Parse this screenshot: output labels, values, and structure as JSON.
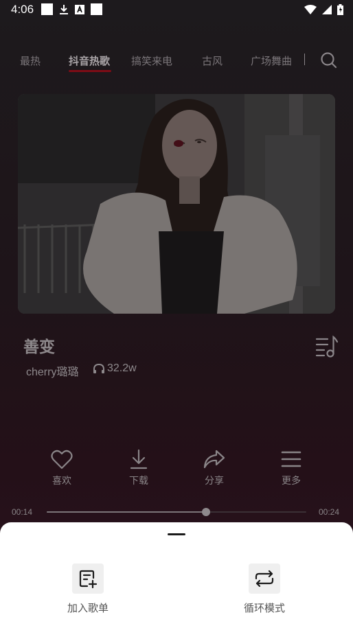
{
  "status_bar": {
    "time": "4:06"
  },
  "tabs": [
    {
      "label": "最热"
    },
    {
      "label": "抖音热歌"
    },
    {
      "label": "搞笑来电"
    },
    {
      "label": "古风"
    },
    {
      "label": "广场舞曲"
    }
  ],
  "song": {
    "title": "善变",
    "artist": "cherry璐璐",
    "plays": "32.2w"
  },
  "actions": [
    {
      "label": "喜欢",
      "icon": "heart-icon"
    },
    {
      "label": "下载",
      "icon": "download-icon"
    },
    {
      "label": "分享",
      "icon": "share-icon"
    },
    {
      "label": "更多",
      "icon": "menu-icon"
    }
  ],
  "player": {
    "current_time": "00:14",
    "total_time": "00:24",
    "progress_fraction": 0.615
  },
  "sheet": {
    "items": [
      {
        "label": "加入歌单",
        "icon": "add-playlist-icon"
      },
      {
        "label": "循环模式",
        "icon": "repeat-icon"
      }
    ]
  },
  "colors": {
    "accent": "#7e0c16",
    "sheet_bg": "#ffffff"
  }
}
